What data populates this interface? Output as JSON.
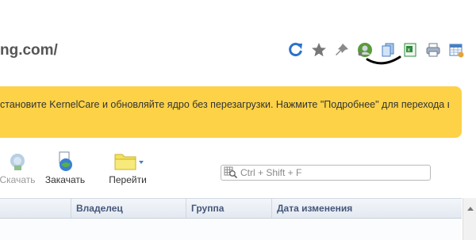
{
  "page": {
    "url_title": "ng.com/"
  },
  "toolbar_icons": [
    {
      "name": "refresh-icon",
      "color": "#2c73c8"
    },
    {
      "name": "star-icon",
      "color": "#777777"
    },
    {
      "name": "pin-icon",
      "color": "#888888"
    },
    {
      "name": "user-avatar-icon",
      "color": "#5a9a3a"
    },
    {
      "name": "copy-icon",
      "color": "#4a7fc0"
    },
    {
      "name": "excel-icon",
      "color": "#2e8b3a"
    },
    {
      "name": "print-icon",
      "color": "#6b7a8c"
    },
    {
      "name": "calendar-settings-icon",
      "color": "#4a7fc0"
    }
  ],
  "banner": {
    "text": "становите KernelCare и обновляйте ядро без перезагрузки. Нажмите \"Подробнее\" для перехода в",
    "color": "#fdd247"
  },
  "actions": {
    "download_label": "Скачать",
    "upload_label": "Закачать",
    "goto_label": "Перейти"
  },
  "search": {
    "placeholder": "Ctrl + Shift + F"
  },
  "table": {
    "columns": [
      "Владелец",
      "Группа",
      "Дата изменения"
    ]
  }
}
